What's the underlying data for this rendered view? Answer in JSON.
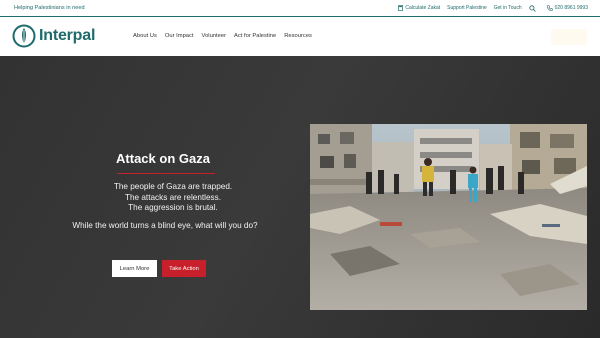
{
  "topbar": {
    "tagline": "Helping Palestinians in need",
    "links": {
      "calculate_zakat": "Calculate Zakat",
      "support_palestine": "Support Palestine",
      "get_in_touch": "Get in Touch",
      "phone": "020 8961 9993"
    },
    "icons": [
      "calculator-icon",
      "search-icon",
      "phone-icon"
    ]
  },
  "header": {
    "logo_text": "Interpal",
    "nav": [
      "About Us",
      "Our Impact",
      "Volunteer",
      "Act for Palestine",
      "Resources"
    ]
  },
  "hero": {
    "title": "Attack on Gaza",
    "lines": [
      "The people of Gaza are trapped.",
      "The attacks are relentless.",
      "The aggression is brutal."
    ],
    "question": "While the world turns a blind eye, what will you do?",
    "buttons": {
      "learn_more": "Learn More",
      "take_action": "Take Action"
    }
  },
  "colors": {
    "brand": "#1f6b6b",
    "accent_red": "#c8202a",
    "hero_bg": "#333333"
  }
}
